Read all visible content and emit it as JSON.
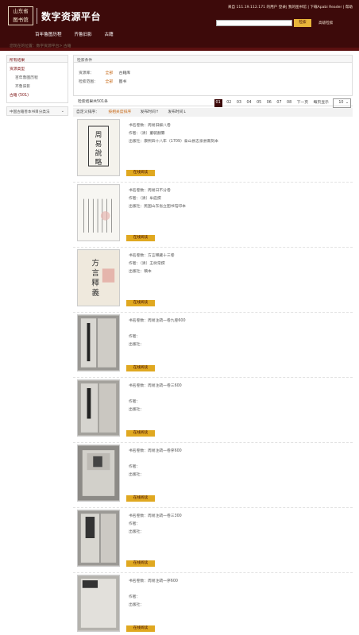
{
  "header": {
    "logo_line1": "山东省",
    "logo_line2": "图书馆",
    "title": "数字资源平台",
    "top_links": "来自 111.19.112.171 的用户  登录| 我的图书馆 | 下载Apabi Reader | 帮助",
    "search_placeholder": "",
    "search_button": "检索",
    "advanced_search": "高级检索",
    "nav": [
      "百年鲁图历程",
      "齐鲁旧影",
      "古籍"
    ]
  },
  "breadcrumb": "您现在的位置：数字资源平台> 古籍",
  "sidebar": {
    "all_results": "所有结果",
    "sections": [
      {
        "label": "资源类型",
        "items": [
          "百年鲁图历程",
          "齐鲁旧影"
        ],
        "highlight": "古籍 (501)"
      }
    ],
    "classification": "中国古籍善本书目分类法"
  },
  "conditions": {
    "header": "检索条件",
    "row1_key": "资源库：",
    "row1_values": [
      "全部",
      "古籍库"
    ],
    "row2_key": "检索范围：",
    "row2_values": [
      "全部",
      "图书"
    ]
  },
  "results": {
    "count_text": "检索结果共501条",
    "pages": [
      "01",
      "02",
      "03",
      "04",
      "05",
      "06",
      "07",
      "08",
      "下一页"
    ],
    "per_page_label": "每页显示",
    "per_page_value": "10"
  },
  "sort": {
    "label": "自定义排序：",
    "options": [
      "按相关度排序",
      "发布时间↑",
      "发布时间↓"
    ]
  },
  "items": [
    {
      "title": "书名卷数：周易旧解八卷",
      "author": "作者：（清）董毓翻纂",
      "pub": "出版社：康熙四十八年（1709）泰山县志泉县斋刻本",
      "btn": "在线阅读"
    },
    {
      "title": "书名卷数：周易日不分卷",
      "author": "作者：（清）牟庭撰",
      "pub": "出版社：民国山东省立图书馆印本",
      "btn": "在线阅读"
    },
    {
      "title": "书名卷数：方言释藏十三卷",
      "author": "作者：（清）王树常撰",
      "pub": "出版社：稿本",
      "btn": "在线阅读"
    },
    {
      "title": "书名卷数：周易注疏一卷九卷600",
      "author": "作者：",
      "pub": "出版社：",
      "btn": "在线阅读"
    },
    {
      "title": "书名卷数：周易注疏一卷三600",
      "author": "作者：",
      "pub": "出版社：",
      "btn": "在线阅读"
    },
    {
      "title": "书名卷数：周易注疏一卷序600",
      "author": "作者：",
      "pub": "出版社：",
      "btn": "在线阅读"
    },
    {
      "title": "书名卷数：周易注疏一卷三300",
      "author": "作者：",
      "pub": "出版社：",
      "btn": "在线阅读"
    },
    {
      "title": "书名卷数：周易注疏一序600",
      "author": "作者：",
      "pub": "出版社：",
      "btn": "在线阅读"
    }
  ],
  "colors": {
    "brand": "#3d0a0a",
    "accent": "#e0a820",
    "link": "#c86a18"
  }
}
